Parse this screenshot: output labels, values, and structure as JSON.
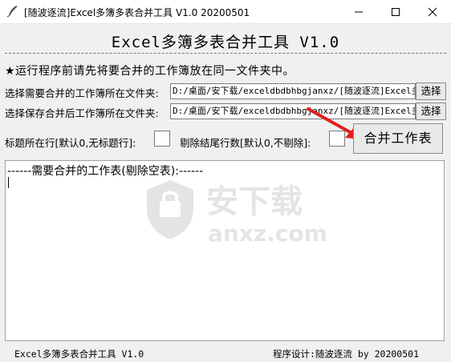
{
  "window": {
    "title": "[随波逐流]Excel多簿多表合并工具 V1.0        20200501"
  },
  "header": {
    "app_title": "Excel多簿多表合并工具 V1.0",
    "notice": "★运行程序前请先将要合并的工作簿放在同一文件夹中。"
  },
  "source_folder": {
    "label": "选择需要合并的工作簿所在文件夹:",
    "value": "D:/桌面/安下载/exceldbdbhbgjanxz/[随波逐流]Excel多簿多表合并工具",
    "button_label": "选择"
  },
  "output_folder": {
    "label": "选择保存合并后工作簿所在文件夹:",
    "value": "D:/桌面/安下载/exceldbdbhbgjanxz/[随波逐流]Excel多簿多表合并工具",
    "button_label": "选择"
  },
  "options": {
    "title_row_label": "标题所在行[默认0,无标题行]:",
    "title_row_value": "",
    "trailing_rows_label": "剔除结尾行数[默认0,不剔除]:",
    "trailing_rows_value": ""
  },
  "merge_button_label": "合并工作表",
  "log": {
    "first_line": "------需要合并的工作表(剔除空表):------"
  },
  "watermark": {
    "text": "安下载",
    "domain": "anxz.com"
  },
  "footer": {
    "left": "Excel多簿多表合并工具 V1.0",
    "right": "程序设计:随波逐流 by 20200501"
  },
  "icons": {
    "app": "feather-icon",
    "minimize": "minimize-icon",
    "maximize": "maximize-icon",
    "close": "close-icon",
    "annotation": "red-arrow-icon"
  },
  "colors": {
    "window_bg": "#f0f0f0",
    "arrow": "#e0201c"
  }
}
